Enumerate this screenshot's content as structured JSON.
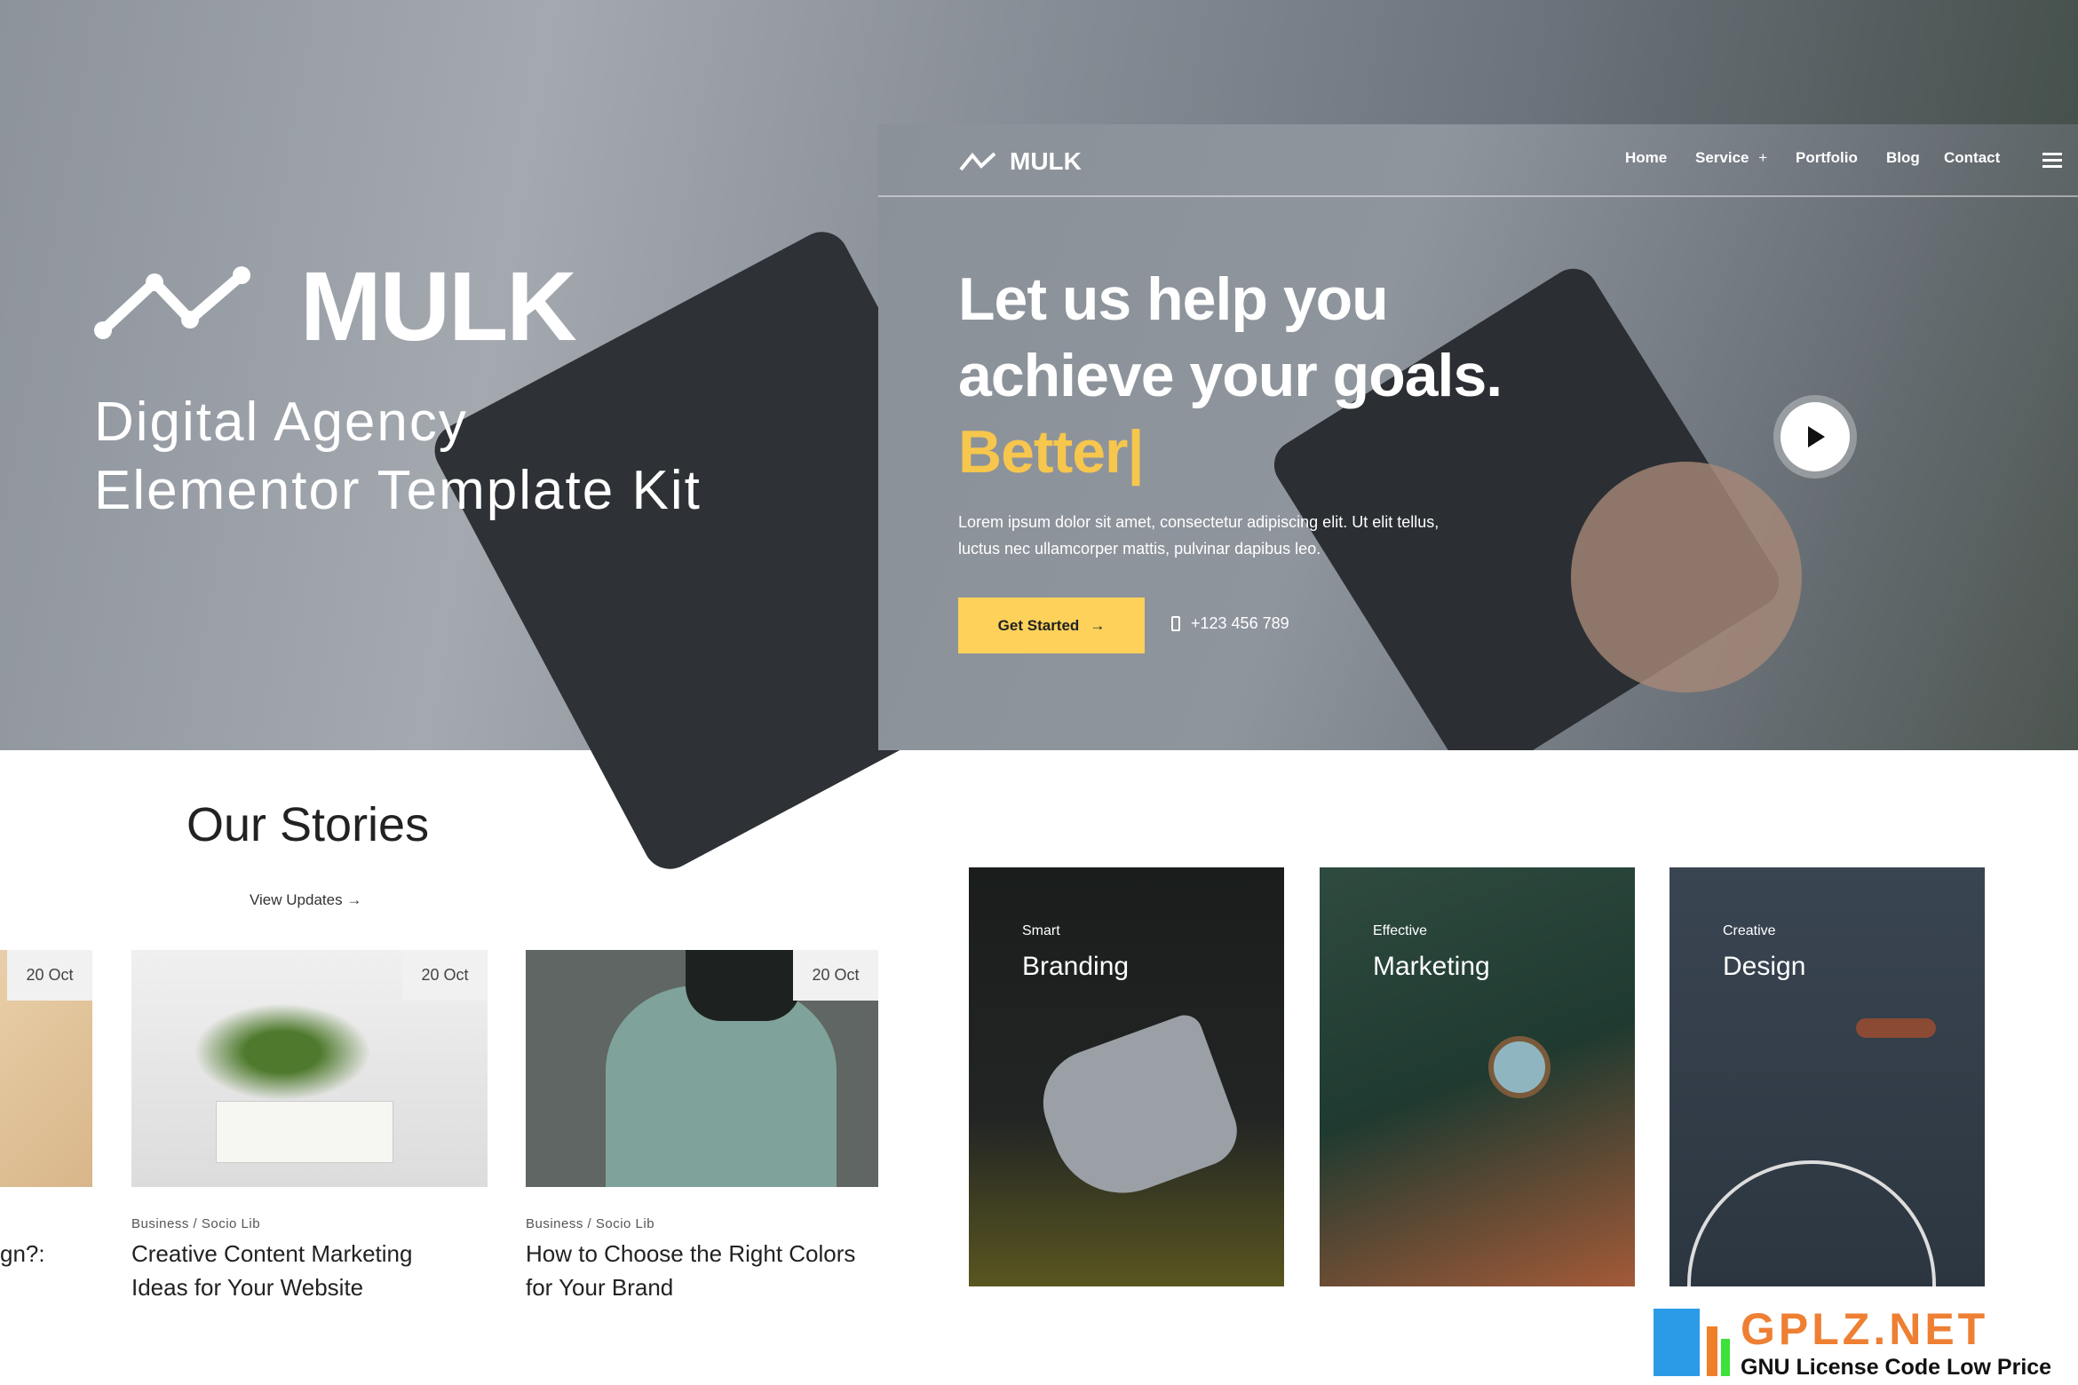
{
  "left_hero": {
    "logo_text": "MULK",
    "subtitle_line1": "Digital Agency",
    "subtitle_line2": "Elementor Template Kit"
  },
  "nav": {
    "logo_text": "MULK",
    "items": [
      "Home",
      "Service",
      "Portfolio",
      "Blog",
      "Contact"
    ],
    "service_plus": "+"
  },
  "hero": {
    "line1": "Let us help you",
    "line2": "achieve your goals.",
    "line3": "Better|",
    "paragraph_line1": "Lorem ipsum dolor sit amet, consectetur adipiscing elit. Ut elit tellus,",
    "paragraph_line2": "luctus nec ullamcorper mattis, pulvinar dapibus leo.",
    "cta": "Get Started",
    "cta_arrow": "→",
    "phone": "+123 456 789",
    "accent": "#fdd15a"
  },
  "stories": {
    "title": "Our Stories",
    "view_updates": "View Updates",
    "arrow": "→",
    "posts": [
      {
        "date": "20 Oct",
        "title_fragment": "gn?:"
      },
      {
        "date": "20 Oct",
        "meta": "Business  /  Socio Lib",
        "title_line1": "Creative Content Marketing",
        "title_line2": "Ideas for Your Website"
      },
      {
        "date": "20 Oct",
        "meta": "Business  /  Socio Lib",
        "title_line1": "How to Choose the Right Colors",
        "title_line2": "for Your Brand"
      }
    ]
  },
  "services": [
    {
      "label": "Smart",
      "title": "Branding"
    },
    {
      "label": "Effective",
      "title": "Marketing"
    },
    {
      "label": "Creative",
      "title": "Design"
    }
  ],
  "watermark": {
    "brand": "GPLZ.NET",
    "tagline": "GNU License Code Low Price"
  }
}
